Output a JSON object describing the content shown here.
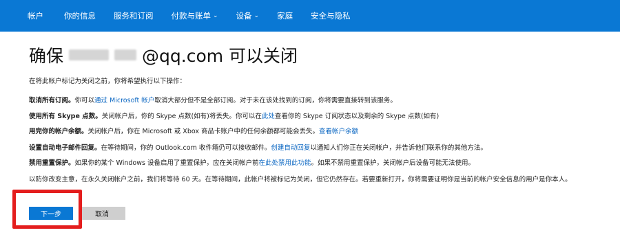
{
  "nav": {
    "items": [
      {
        "label": "帐户",
        "dropdown": false
      },
      {
        "label": "你的信息",
        "dropdown": false
      },
      {
        "label": "服务和订阅",
        "dropdown": false
      },
      {
        "label": "付款与账单",
        "dropdown": true
      },
      {
        "label": "设备",
        "dropdown": true
      },
      {
        "label": "家庭",
        "dropdown": false
      },
      {
        "label": "安全与隐私",
        "dropdown": false
      }
    ]
  },
  "page": {
    "title_prefix": "确保",
    "title_suffix": "@qq.com 可以关闭",
    "intro": "在将此帐户标记为关闭之前，你将希望执行以下操作："
  },
  "items": {
    "subscriptions": {
      "bold": "取消所有订阅。",
      "pre": "你可以",
      "link": "通过 Microsoft 帐户",
      "post": "取消大部分但不是全部订阅。对于未在该处找到的订阅，你将需要直接转到该服务。"
    },
    "skype": {
      "bold": "使用所有 Skype 点数。",
      "pre": "关闭帐户后，你的 Skype 点数(如有)将丢失。你可以在",
      "link": "此处",
      "post": "查看你的 Skype 订阅状态以及剩余的 Skype 点数(如有)"
    },
    "balance": {
      "bold": "用完你的帐户余额。",
      "pre": "关闭帐户后，你在 Microsoft 或 Xbox 商品卡账户中的任何余额都可能会丢失。",
      "link": "查看帐户余额"
    },
    "autoreply": {
      "bold": "设置自动电子邮件回复。",
      "pre": "在等待期间，你的 Outlook.com 收件箱仍可以接收邮件。",
      "link": "创建自动回复",
      "post": "以通知人们你正在关闭帐户，并告诉他们联系你的其他方法。"
    },
    "reset": {
      "bold": "禁用重置保护。",
      "pre": "如果你的某个 Windows 设备启用了重置保护，应在关闭帐户前",
      "link": "在此处禁用此功能",
      "post": "。如果不禁用重置保护，关闭帐户后设备可能无法使用。"
    }
  },
  "notice": "以防你改变主意，在永久关闭帐户之前，我们将等待 60 天。在等待期间，此帐户将被标记为关闭，但它仍然存在。若要重新打开，你将需要证明你是当前的帐户安全信息的用户是你本人。",
  "buttons": {
    "next": "下一步",
    "cancel": "取消"
  },
  "colors": {
    "nav_bg": "#0a78d4",
    "link": "#0a66c2",
    "highlight": "#e41d1d"
  }
}
